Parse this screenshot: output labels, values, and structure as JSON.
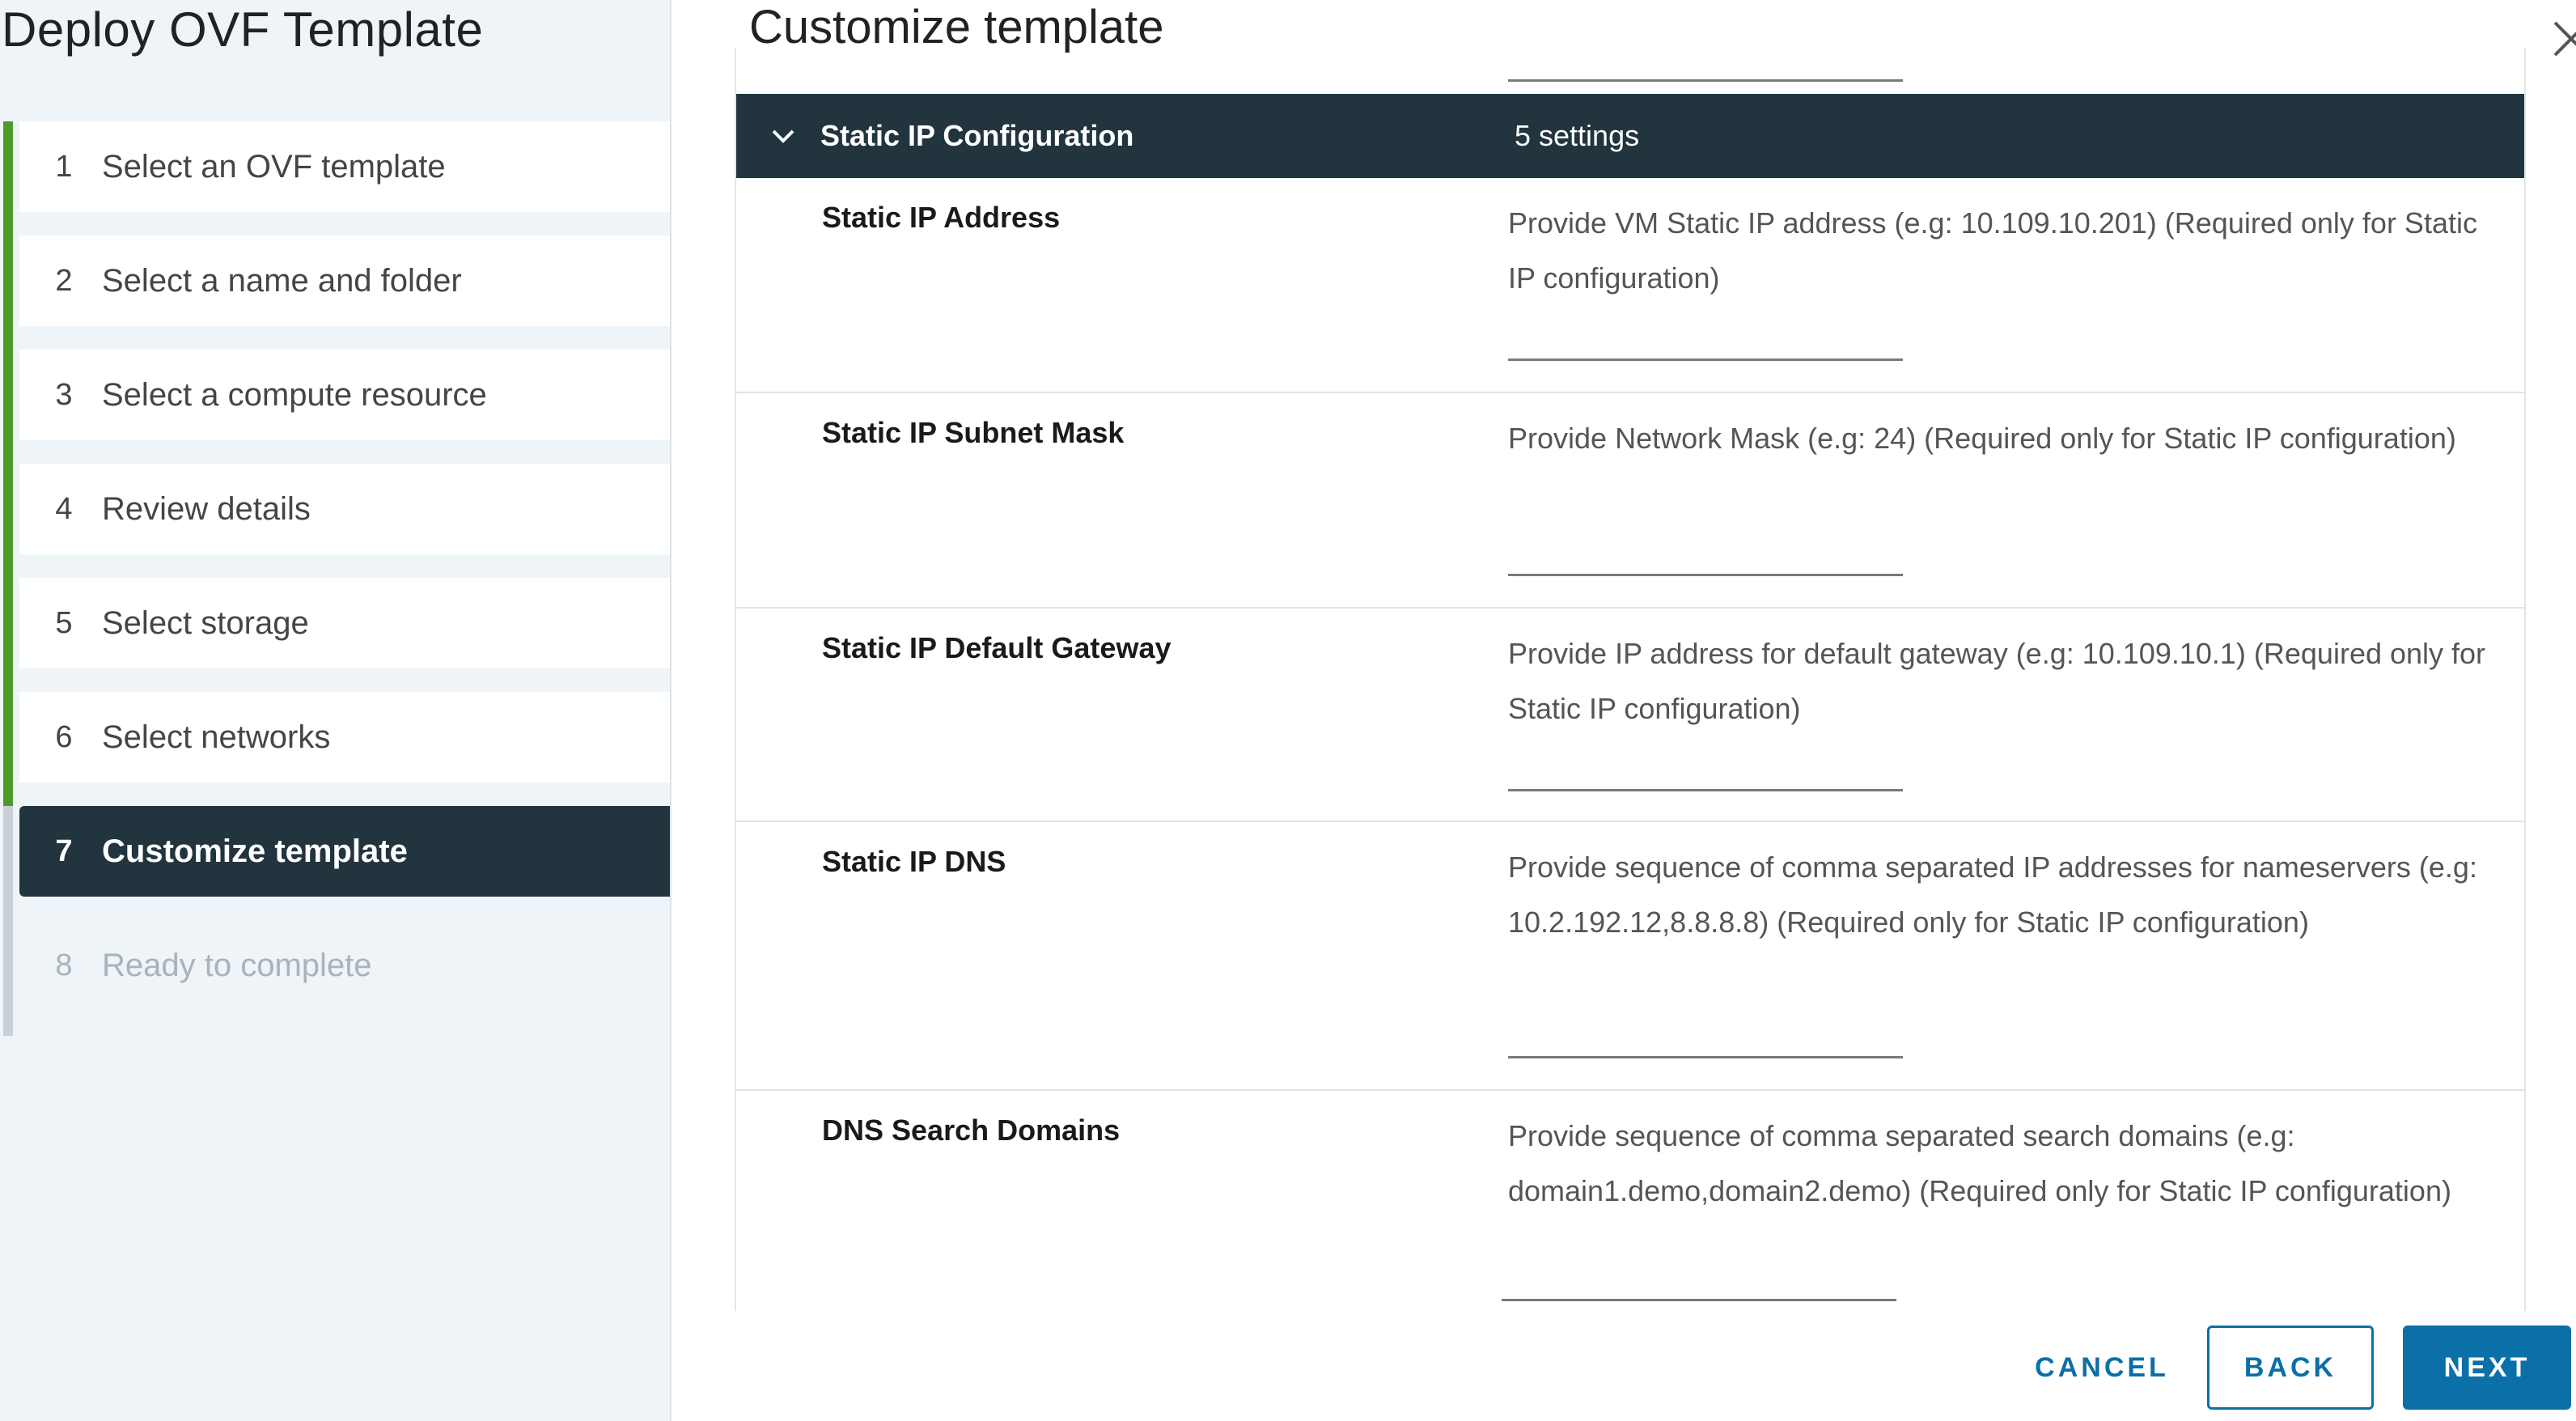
{
  "sidebar": {
    "title": "Deploy OVF Template",
    "steps": [
      {
        "num": "1",
        "label": "Select an OVF template"
      },
      {
        "num": "2",
        "label": "Select a name and folder"
      },
      {
        "num": "3",
        "label": "Select a compute resource"
      },
      {
        "num": "4",
        "label": "Review details"
      },
      {
        "num": "5",
        "label": "Select storage"
      },
      {
        "num": "6",
        "label": "Select networks"
      },
      {
        "num": "7",
        "label": "Customize template"
      },
      {
        "num": "8",
        "label": "Ready to complete"
      }
    ],
    "active_step": "7"
  },
  "main": {
    "title": "Customize template",
    "group": {
      "title": "Static IP Configuration",
      "count": "5 settings"
    },
    "settings": [
      {
        "key": "Static IP Address",
        "desc": "Provide VM Static IP address (e.g: 10.109.10.201)  (Required only for Static IP configuration)",
        "value": ""
      },
      {
        "key": "Static IP Subnet Mask",
        "desc": "Provide Network Mask (e.g: 24) (Required only for Static IP configuration)",
        "value": ""
      },
      {
        "key": "Static IP Default Gateway",
        "desc": "Provide IP address for default gateway (e.g: 10.109.10.1) (Required only for Static IP configuration)",
        "value": ""
      },
      {
        "key": "Static IP DNS",
        "desc": "Provide sequence of comma separated IP addresses for nameservers (e.g: 10.2.192.12,8.8.8.8) (Required only for Static IP configuration)",
        "value": ""
      },
      {
        "key": "DNS Search Domains",
        "desc": "Provide sequence of comma separated search domains (e.g: domain1.demo,domain2.demo) (Required only for Static IP configuration)",
        "value": ""
      }
    ]
  },
  "footer": {
    "cancel": "CANCEL",
    "back": "BACK",
    "next": "NEXT"
  },
  "colors": {
    "active_step_bg": "#22343e",
    "progress_done": "#4c9a2a",
    "primary": "#0b6fa8"
  },
  "icons": {
    "close": "close-icon",
    "chevron": "chevron-down-icon"
  }
}
